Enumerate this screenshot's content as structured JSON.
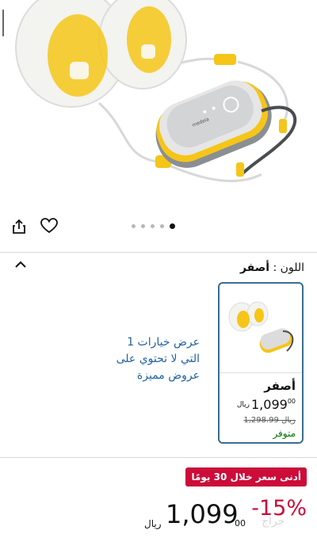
{
  "hero": {
    "brand_mark": "medela",
    "colors": {
      "yellow": "#f5c518",
      "grey": "#c8c8c8",
      "dark_grey": "#555a5e"
    }
  },
  "carousel": {
    "total": 5,
    "active_index": 4
  },
  "color_selection": {
    "label": "اللون :",
    "selected": "أصفر"
  },
  "variant": {
    "name": "أصفر",
    "currency": "ريال",
    "price_int": "1,099",
    "price_frac": "00",
    "old_price": "1,298.99 ريال",
    "availability": "متوفر"
  },
  "other_options_text": "عرض خيارات 1 التي لا تحتوي على عروض مميزة",
  "price_block": {
    "deal_badge": "أدنى سعر خلال 30 يومًا",
    "discount": "-15%",
    "currency": "ريال",
    "price_int": "1,099",
    "price_frac": "00"
  },
  "watermark": "حراج",
  "accent_colors": {
    "link": "#2162a1",
    "deal": "#cc0c39",
    "stock": "#007600",
    "selected_border": "#3a6d93"
  }
}
